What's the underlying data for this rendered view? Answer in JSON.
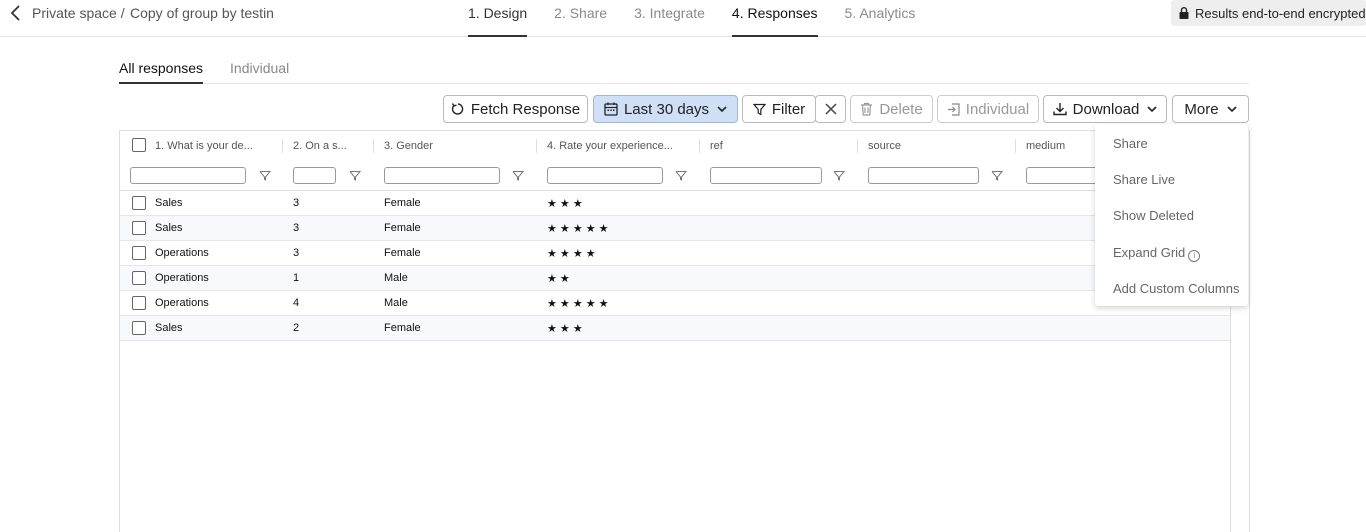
{
  "header": {
    "breadcrumb_space": "Private space /",
    "breadcrumb_title": "Copy of group by testin",
    "tabs": [
      {
        "label": "1. Design"
      },
      {
        "label": "2. Share"
      },
      {
        "label": "3. Integrate"
      },
      {
        "label": "4. Responses"
      },
      {
        "label": "5. Analytics"
      }
    ],
    "active_tab": "4. Responses",
    "encrypted_label": "Results end-to-end encrypted"
  },
  "subtabs": [
    {
      "label": "All responses"
    },
    {
      "label": "Individual"
    }
  ],
  "toolbar": {
    "fetch_label": "Fetch Response",
    "date_label": "Last 30 days",
    "filter_label": "Filter",
    "delete_label": "Delete",
    "individual_label": "Individual",
    "download_label": "Download",
    "more_label": "More"
  },
  "grid": {
    "columns": [
      {
        "label": "1. What is your de..."
      },
      {
        "label": "2. On a s..."
      },
      {
        "label": "3. Gender"
      },
      {
        "label": "4. Rate your experience..."
      },
      {
        "label": "ref"
      },
      {
        "label": "source"
      },
      {
        "label": "medium"
      }
    ],
    "rows": [
      {
        "department": "Sales",
        "scale": "3",
        "gender": "Female",
        "rating": "★ ★ ★"
      },
      {
        "department": "Sales",
        "scale": "3",
        "gender": "Female",
        "rating": "★ ★ ★ ★ ★"
      },
      {
        "department": "Operations",
        "scale": "3",
        "gender": "Female",
        "rating": "★ ★ ★ ★"
      },
      {
        "department": "Operations",
        "scale": "1",
        "gender": "Male",
        "rating": "★ ★"
      },
      {
        "department": "Operations",
        "scale": "4",
        "gender": "Male",
        "rating": "★ ★ ★ ★ ★"
      },
      {
        "department": "Sales",
        "scale": "2",
        "gender": "Female",
        "rating": "★ ★ ★"
      }
    ]
  },
  "more_menu": {
    "items": [
      {
        "label": "Share"
      },
      {
        "label": "Share Live"
      },
      {
        "label": "Show Deleted"
      },
      {
        "label": "Expand Grid"
      },
      {
        "label": "Add Custom Columns"
      }
    ]
  },
  "colors": {
    "date_button_bg": "#cfe0f6",
    "active_underline": "#333333",
    "alt_row_bg": "#f7f9fc"
  }
}
